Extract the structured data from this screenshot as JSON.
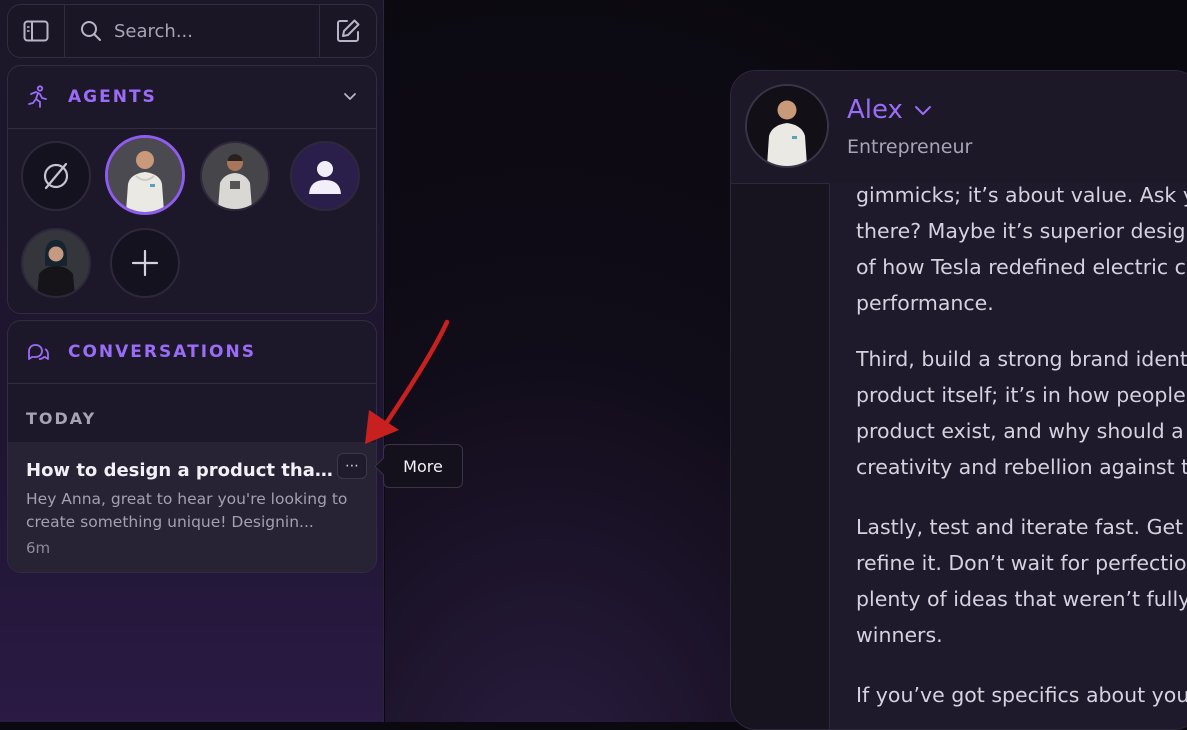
{
  "search": {
    "placeholder": "Search..."
  },
  "agents": {
    "title": "AGENTS"
  },
  "conversations": {
    "title": "CONVERSATIONS",
    "section": "TODAY",
    "items": [
      {
        "title": "How to design a product that st...",
        "preview": "Hey Anna, great to hear you're looking to create something unique! Designin...",
        "time": "6m",
        "more_label": "⋯"
      }
    ]
  },
  "tooltip": {
    "text": "More"
  },
  "chat": {
    "agent_name": "Alex",
    "agent_role": "Entrepreneur",
    "paragraphs": [
      [
        "gimmicks; it’s about value. Ask y",
        "there? Maybe it’s superior desig",
        "of how Tesla redefined electric c",
        "performance."
      ],
      [
        "Third, build a strong brand ident",
        "product itself; it’s in how people",
        "product exist, and why should a",
        "creativity and rebellion against t"
      ],
      [
        "Lastly, test and iterate fast. Get a",
        "refine it. Don’t wait for perfectio",
        "plenty of ideas that weren’t fully",
        "winners."
      ],
      [
        "If you’ve got specifics about you"
      ]
    ]
  },
  "colors": {
    "accent": "#9b6cf7",
    "annotation_arrow": "#c8201e"
  }
}
